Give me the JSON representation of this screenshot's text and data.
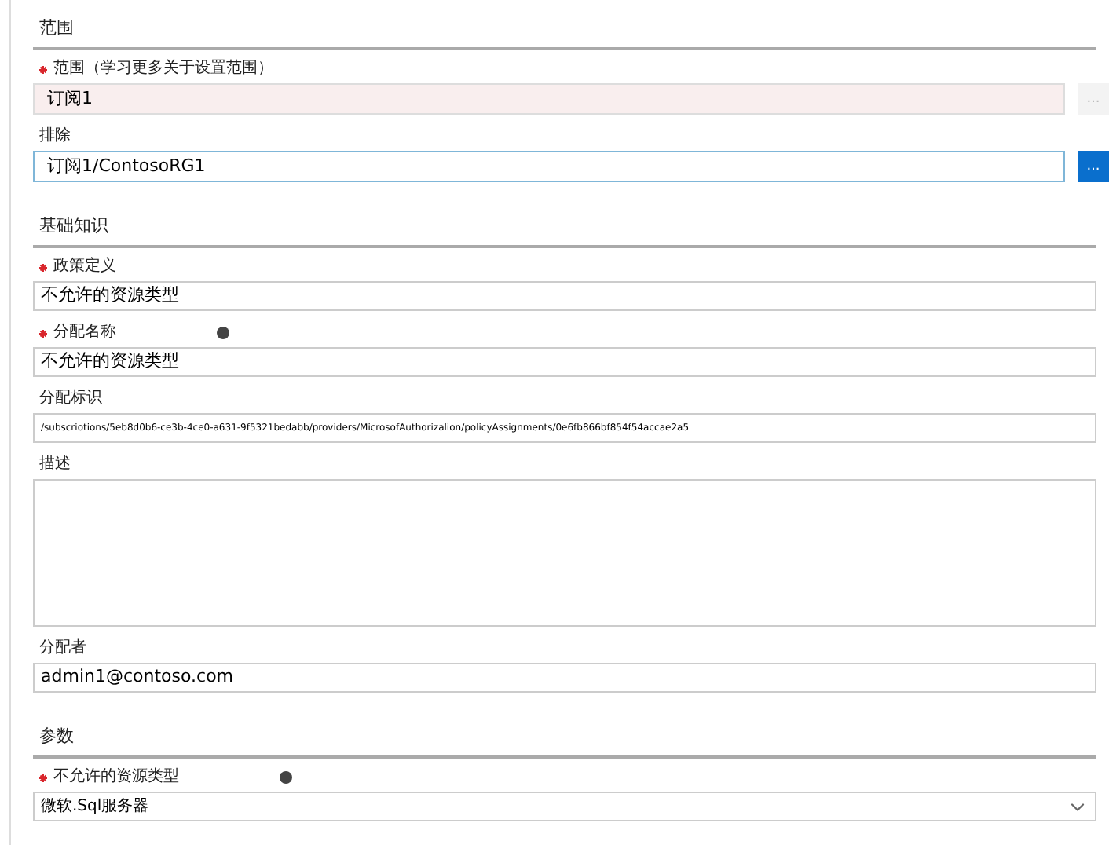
{
  "sections": [
    {
      "title": "范围",
      "fields": [
        {
          "label": "范围（学习更多关于设置范围）",
          "required": true,
          "kind": "browse",
          "value": "订阅1",
          "disabled": true,
          "button": "..."
        },
        {
          "label": "排除",
          "required": false,
          "kind": "browse",
          "value": "订阅1/ContosoRG1",
          "disabled": false,
          "button": "..."
        }
      ]
    },
    {
      "title": "基础知识",
      "fields": [
        {
          "label": "政策定义",
          "required": true,
          "kind": "text",
          "value": "不允许的资源类型"
        },
        {
          "label": "分配名称",
          "required": true,
          "info": true,
          "kind": "text",
          "value": "不允许的资源类型"
        },
        {
          "label": "分配标识",
          "required": false,
          "kind": "id",
          "value": "/subscriotions/5eb8d0b6-ce3b-4ce0-a631-9f5321bedabb/providers/MicrosofAuthorizalion/policyAssignments/0e6fb866bf854f54accae2a5"
        },
        {
          "label": "描述",
          "required": false,
          "kind": "textarea"
        },
        {
          "label": "分配者",
          "required": false,
          "kind": "text",
          "value": "admin1@contoso.com"
        }
      ]
    },
    {
      "title": "参数",
      "fields": [
        {
          "label": "不允许的资源类型",
          "required": true,
          "info": true,
          "kind": "select",
          "value": "微软.Sql服务器"
        }
      ]
    }
  ]
}
